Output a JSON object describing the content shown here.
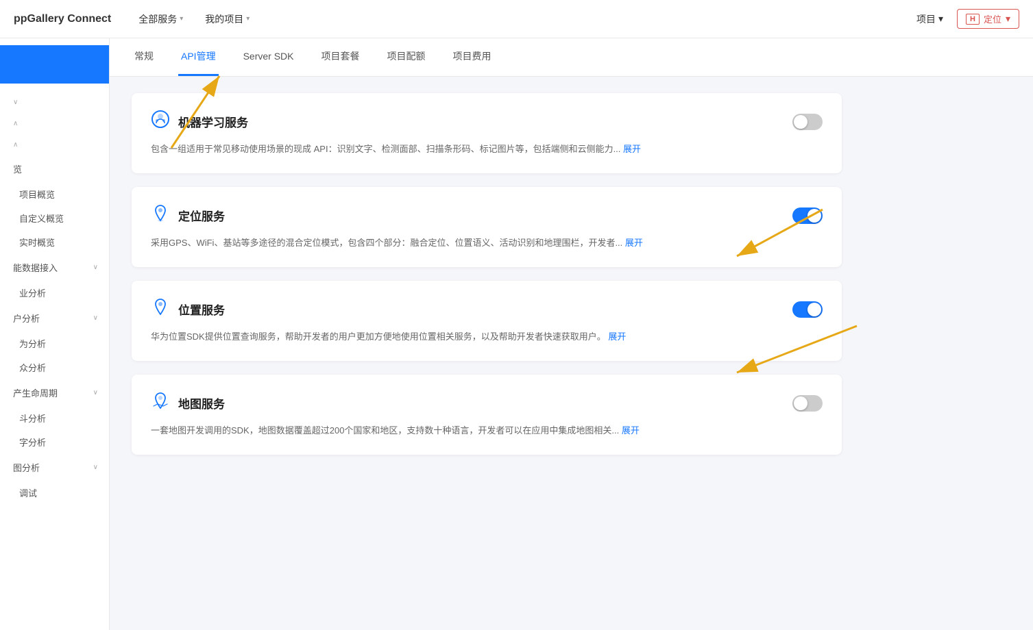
{
  "topNav": {
    "logo": "ppGallery Connect",
    "navItems": [
      {
        "label": "全部服务",
        "hasChevron": true
      },
      {
        "label": "我的项目",
        "hasChevron": true
      }
    ],
    "projectBtn": {
      "label": "项目",
      "hasChevron": true
    },
    "locationBtn": {
      "icon": "H",
      "label": "定位",
      "hasChevron": true
    }
  },
  "tabs": [
    {
      "label": "常规",
      "active": false
    },
    {
      "label": "API管理",
      "active": true
    },
    {
      "label": "Server SDK",
      "active": false
    },
    {
      "label": "项目套餐",
      "active": false
    },
    {
      "label": "项目配额",
      "active": false
    },
    {
      "label": "项目费用",
      "active": false
    }
  ],
  "sidebar": {
    "topBlue": true,
    "items": [
      {
        "label": "",
        "collapsed": true,
        "indent": false
      },
      {
        "label": "",
        "collapsed": false,
        "indent": false
      },
      {
        "label": "",
        "collapsed": true,
        "indent": false
      },
      {
        "label": "览",
        "sub": true
      },
      {
        "label": "项目概览",
        "sub": true
      },
      {
        "label": "自定义概览",
        "sub": true
      },
      {
        "label": "实时概览",
        "sub": true
      },
      {
        "label": "能数据接入",
        "collapsed": true
      },
      {
        "label": "业分析",
        "sub": false
      },
      {
        "label": "户分析",
        "collapsed": true
      },
      {
        "label": "为分析",
        "sub": false
      },
      {
        "label": "众分析",
        "sub": false
      },
      {
        "label": "产生命周期",
        "collapsed": true
      },
      {
        "label": "斗分析",
        "sub": false
      },
      {
        "label": "字分析",
        "sub": false
      },
      {
        "label": "图分析",
        "collapsed": true
      },
      {
        "label": "调试",
        "sub": false
      }
    ]
  },
  "services": [
    {
      "id": "ml",
      "icon": "🤖",
      "iconUnicode": "brain",
      "title": "机器学习服务",
      "desc": "包含一组适用于常见移动使用场景的现成 API：识别文字、检测面部、扫描条形码、标记图片等，包括端侧和云侧能力...",
      "expandLabel": "展开",
      "enabled": false
    },
    {
      "id": "location",
      "icon": "📍",
      "iconUnicode": "location",
      "title": "定位服务",
      "desc": "采用GPS、WiFi、基站等多途径的混合定位模式，包含四个部分：融合定位、位置语义、活动识别和地理围栏，开发者...",
      "expandLabel": "展开",
      "enabled": true
    },
    {
      "id": "position",
      "icon": "📍",
      "iconUnicode": "position",
      "title": "位置服务",
      "desc": "华为位置SDK提供位置查询服务，帮助开发者的用户更加方便地使用位置相关服务，以及帮助开发者快速获取用户。",
      "expandLabel": "展开",
      "enabled": true
    },
    {
      "id": "map",
      "icon": "🗺️",
      "iconUnicode": "map",
      "title": "地图服务",
      "desc": "一套地图开发调用的SDK，地图数据覆盖超过200个国家和地区，支持数十种语言，开发者可以在应用中集成地图相关...",
      "expandLabel": "展开",
      "enabled": false
    }
  ]
}
